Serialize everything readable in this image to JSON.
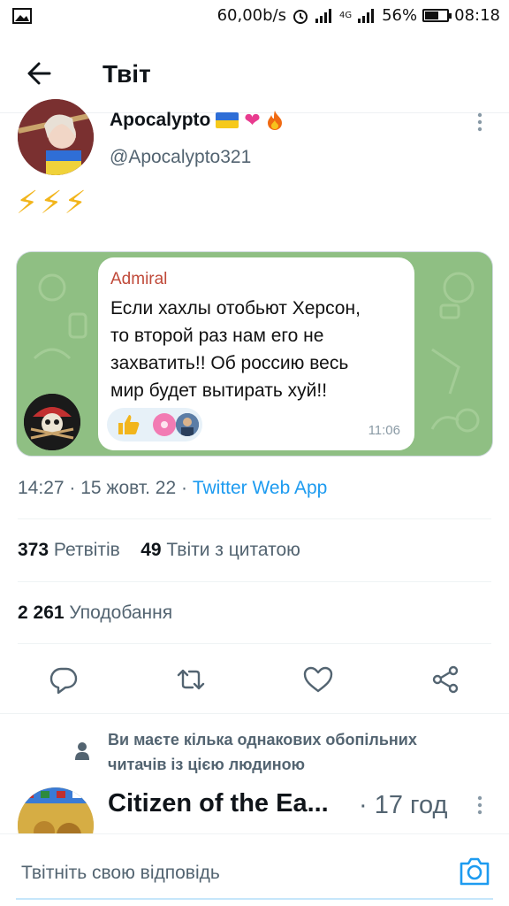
{
  "status_bar": {
    "speed": "60,00b/s",
    "network": "4G",
    "battery_percent": "56%",
    "battery_level": 0.56,
    "time": "08:18"
  },
  "header": {
    "title": "Твіт"
  },
  "tweet": {
    "author_name": "Apocalypto",
    "author_handle": "@Apocalypto321",
    "text": "⚡⚡⚡",
    "media": {
      "sender": "Admiral",
      "message_lines": [
        "Если хахлы отобьют Херсон,",
        "то второй раз нам его не",
        "захватить!! Об россию весь",
        "мир будет вытирать хуй!!"
      ],
      "time": "11:06"
    },
    "timestamp": "14:27 · 15 жовт. 22 · ",
    "source": "Twitter Web App",
    "retweets_count": "373",
    "retweets_label": "Ретвітів",
    "quotes_count": "49",
    "quotes_label": "Твіти з цитатою",
    "likes_count": "2 261",
    "likes_label": "Уподобання"
  },
  "actions": [
    "reply-icon",
    "retweet-icon",
    "like-icon",
    "share-icon"
  ],
  "social_context": {
    "line1": "Ви маєте кілька однакових обопільних",
    "line2": "читачів із цією людиною"
  },
  "reply": {
    "name": "Citizen of the Ea...",
    "time": "· 17 год"
  },
  "composer": {
    "placeholder": "Твітніть свою відповідь"
  },
  "colors": {
    "accent": "#1d9bf0",
    "secondary_text": "#536471",
    "media_background": "#8fbf83"
  }
}
